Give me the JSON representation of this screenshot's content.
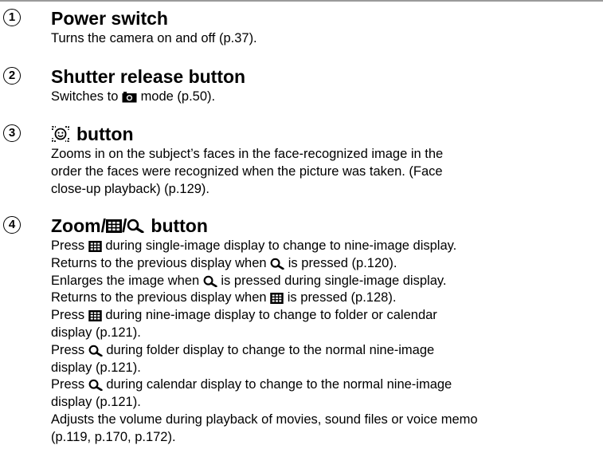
{
  "items": [
    {
      "num": "1",
      "title": "Power switch",
      "desc": [
        "Turns the camera on and off (p.37)."
      ]
    },
    {
      "num": "2",
      "title": "Shutter release button",
      "desc_pre": "Switches to",
      "desc_post": "mode (p.50)."
    },
    {
      "num": "3",
      "title": "button",
      "desc": [
        "Zooms in on the subject’s faces in the face-recognized image in the",
        "order the faces were recognized when the picture was taken. (Face",
        "close-up playback) (p.129)."
      ]
    },
    {
      "num": "4",
      "title_prefix": "Zoom/",
      "title_sep": "/",
      "title_suffix": "button",
      "lines": [
        {
          "pre": "Press",
          "post": "during single-image display to change to nine-image display.",
          "icon": "thumbnail-icon"
        },
        {
          "pre": "Returns to the previous display when",
          "post": "is pressed (p.120).",
          "icon": "zoom-icon"
        },
        {
          "pre": "Enlarges the image when",
          "post": "is pressed during single-image display.",
          "icon": "zoom-icon"
        },
        {
          "pre": "Returns to the previous display when",
          "post": "is pressed (p.128).",
          "icon": "thumbnail-icon"
        },
        {
          "pre": "Press",
          "post": "during nine-image display to change to folder or calendar",
          "icon": "thumbnail-icon"
        },
        {
          "text": "display (p.121)."
        },
        {
          "pre": "Press",
          "post": "during folder display to change to the normal nine-image",
          "icon": "zoom-icon"
        },
        {
          "text": "display (p.121)."
        },
        {
          "pre": "Press",
          "post": "during calendar display to change to the normal nine-image",
          "icon": "zoom-icon"
        },
        {
          "text": "display (p.121)."
        },
        {
          "text": "Adjusts the volume during playback of movies, sound files or voice memo"
        },
        {
          "text": "(p.119, p.170, p.172)."
        }
      ]
    }
  ]
}
